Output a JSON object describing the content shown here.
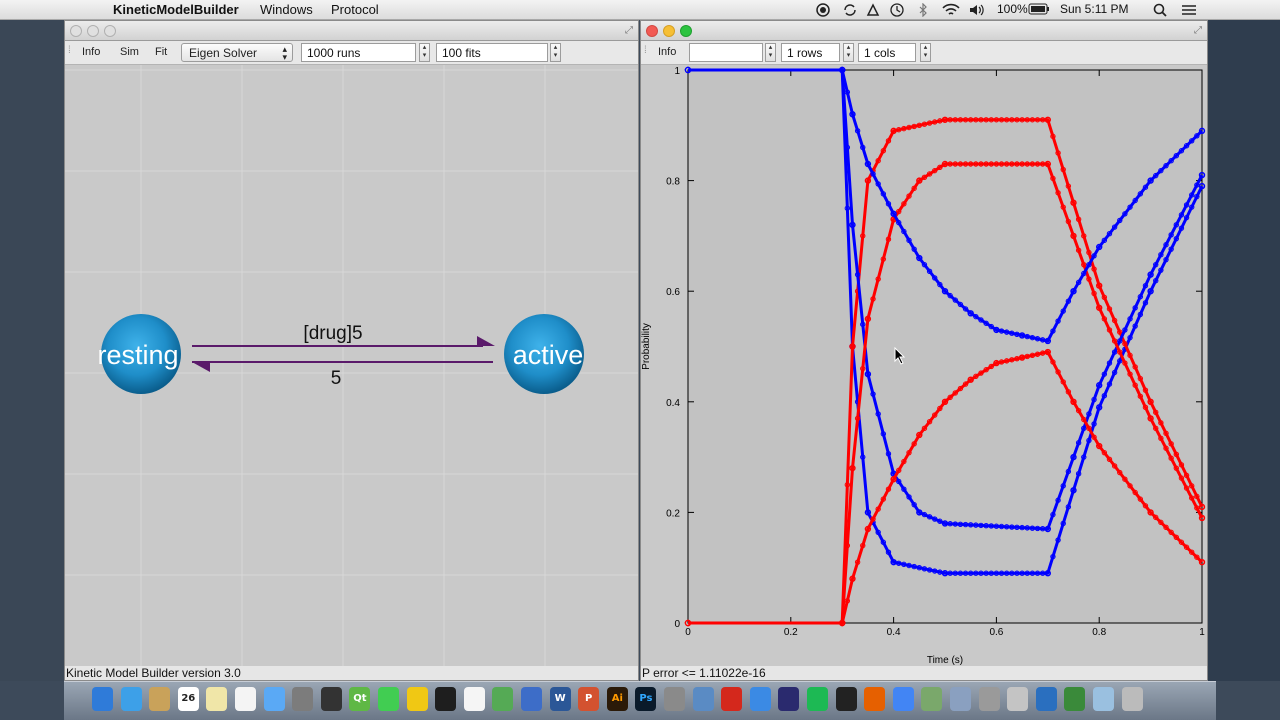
{
  "menubar": {
    "apple_glyph": "",
    "app_name": "KineticModelBuilder",
    "menus": [
      "Windows",
      "Protocol"
    ],
    "battery": "100%",
    "clock": "Sun 5:11 PM"
  },
  "left_window": {
    "toolbar": {
      "info_label": "Info",
      "sim_label": "Sim",
      "fit_label": "Fit",
      "solver_value": "Eigen Solver",
      "runs_value": "1000 runs",
      "fits_value": "100 fits"
    },
    "model": {
      "state_1": "resting",
      "state_2": "active",
      "forward_rate": "[drug]5",
      "backward_rate": "5"
    },
    "status": "Kinetic Model Builder version 3.0"
  },
  "right_window": {
    "toolbar": {
      "info_label": "Info",
      "field_value": "",
      "rows_value": "1 rows",
      "cols_value": "1 cols"
    },
    "status": "P error <= 1.11022e-16"
  },
  "chart_data": {
    "type": "scatter",
    "title": "",
    "xlabel": "Time (s)",
    "ylabel": "Probability",
    "xlim": [
      0,
      1
    ],
    "ylim": [
      0,
      1
    ],
    "xticks": [
      "0",
      "0.2",
      "0.4",
      "0.6",
      "0.8",
      "1"
    ],
    "yticks": [
      "0",
      "0.2",
      "0.4",
      "0.6",
      "0.8",
      "1"
    ],
    "grid": false,
    "colors": {
      "blue": "#0000ff",
      "red": "#ff0000"
    },
    "series": [
      {
        "color": "blue",
        "points": [
          [
            0,
            1
          ],
          [
            0.3,
            1
          ],
          [
            0.32,
            0.5
          ],
          [
            0.35,
            0.2
          ],
          [
            0.4,
            0.11
          ],
          [
            0.5,
            0.09
          ],
          [
            0.7,
            0.09
          ],
          [
            0.75,
            0.24
          ],
          [
            0.8,
            0.39
          ],
          [
            0.9,
            0.6
          ],
          [
            1,
            0.79
          ]
        ]
      },
      {
        "color": "red",
        "points": [
          [
            0,
            0
          ],
          [
            0.3,
            0
          ],
          [
            0.32,
            0.5
          ],
          [
            0.35,
            0.8
          ],
          [
            0.4,
            0.89
          ],
          [
            0.5,
            0.91
          ],
          [
            0.7,
            0.91
          ],
          [
            0.75,
            0.76
          ],
          [
            0.8,
            0.61
          ],
          [
            0.9,
            0.4
          ],
          [
            1,
            0.21
          ]
        ]
      },
      {
        "color": "blue",
        "points": [
          [
            0,
            1
          ],
          [
            0.3,
            1
          ],
          [
            0.32,
            0.72
          ],
          [
            0.35,
            0.45
          ],
          [
            0.4,
            0.27
          ],
          [
            0.45,
            0.2
          ],
          [
            0.5,
            0.18
          ],
          [
            0.7,
            0.17
          ],
          [
            0.75,
            0.3
          ],
          [
            0.8,
            0.43
          ],
          [
            0.9,
            0.63
          ],
          [
            1,
            0.81
          ]
        ]
      },
      {
        "color": "red",
        "points": [
          [
            0,
            0
          ],
          [
            0.3,
            0
          ],
          [
            0.32,
            0.28
          ],
          [
            0.35,
            0.55
          ],
          [
            0.4,
            0.73
          ],
          [
            0.45,
            0.8
          ],
          [
            0.5,
            0.83
          ],
          [
            0.7,
            0.83
          ],
          [
            0.75,
            0.7
          ],
          [
            0.8,
            0.57
          ],
          [
            0.9,
            0.37
          ],
          [
            1,
            0.19
          ]
        ]
      },
      {
        "color": "blue",
        "points": [
          [
            0,
            1
          ],
          [
            0.3,
            1
          ],
          [
            0.32,
            0.92
          ],
          [
            0.35,
            0.83
          ],
          [
            0.4,
            0.74
          ],
          [
            0.45,
            0.66
          ],
          [
            0.5,
            0.6
          ],
          [
            0.55,
            0.56
          ],
          [
            0.6,
            0.53
          ],
          [
            0.65,
            0.52
          ],
          [
            0.7,
            0.51
          ],
          [
            0.75,
            0.6
          ],
          [
            0.8,
            0.68
          ],
          [
            0.9,
            0.8
          ],
          [
            1,
            0.89
          ]
        ]
      },
      {
        "color": "red",
        "points": [
          [
            0,
            0
          ],
          [
            0.3,
            0
          ],
          [
            0.32,
            0.08
          ],
          [
            0.35,
            0.17
          ],
          [
            0.4,
            0.26
          ],
          [
            0.45,
            0.34
          ],
          [
            0.5,
            0.4
          ],
          [
            0.55,
            0.44
          ],
          [
            0.6,
            0.47
          ],
          [
            0.65,
            0.48
          ],
          [
            0.7,
            0.49
          ],
          [
            0.75,
            0.4
          ],
          [
            0.8,
            0.32
          ],
          [
            0.9,
            0.2
          ],
          [
            1,
            0.11
          ]
        ]
      }
    ]
  },
  "dock": {
    "apps": [
      "finder-icon",
      "safari-icon",
      "photos-icon",
      "calendar-icon",
      "notes-icon",
      "reminders-icon",
      "messages-icon",
      "preferences-icon",
      "activity-icon",
      "qt-icon",
      "q-icon",
      "stickies-icon",
      "terminal-icon",
      "textedit-icon",
      "maps-icon",
      "docs-icon",
      "word-icon",
      "powerpoint-icon",
      "illustrator-icon",
      "photoshop-icon",
      "image-capture-icon",
      "preview-icon",
      "acrobat-icon",
      "app-store-icon",
      "inkscape-icon",
      "spotify-icon",
      "github-icon",
      "firefox-icon",
      "chrome-icon",
      "network-icon",
      "mail-icon",
      "calculator-icon",
      "script-icon",
      "globe-icon",
      "textwrangler-icon",
      "grapher-icon",
      "trash-icon"
    ],
    "calendar_day": "26",
    "ai_label": "Ai",
    "ps_label": "Ps",
    "word_label": "W",
    "ppt_label": "P",
    "qt_label": "Qt"
  }
}
